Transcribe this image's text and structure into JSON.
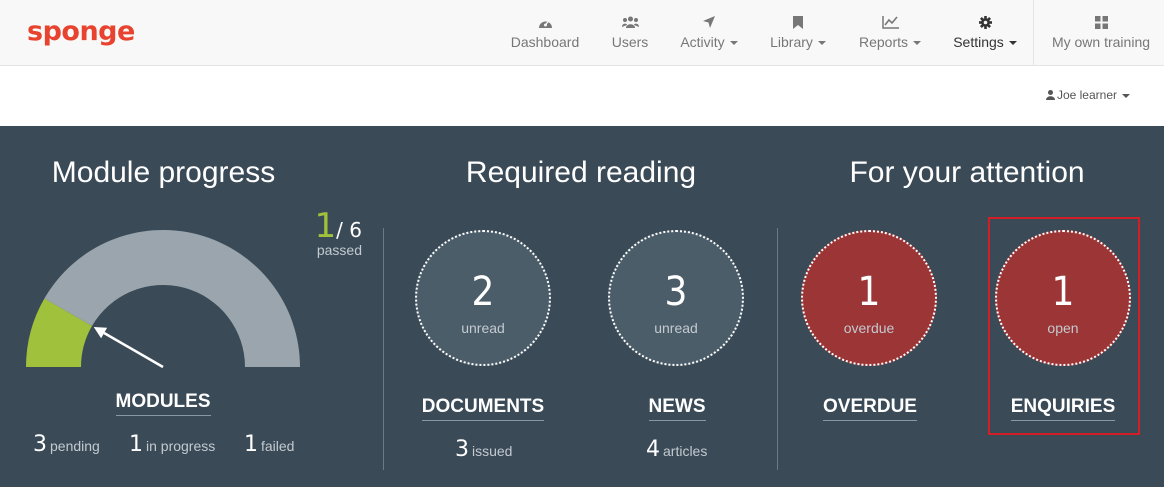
{
  "brand": {
    "logo_text": "sponge",
    "color": "#e8432e"
  },
  "nav": {
    "items": [
      {
        "label": "Dashboard",
        "icon": "dashboard-icon"
      },
      {
        "label": "Users",
        "icon": "users-icon"
      },
      {
        "label": "Activity",
        "icon": "location-arrow-icon"
      },
      {
        "label": "Library",
        "icon": "bookmark-icon"
      },
      {
        "label": "Reports",
        "icon": "line-chart-icon"
      },
      {
        "label": "Settings",
        "icon": "gear-icon"
      },
      {
        "label": "My own training",
        "icon": "grid-icon"
      }
    ]
  },
  "user": {
    "name": "Joe learner",
    "icon": "user-icon"
  },
  "module_progress": {
    "title": "Module progress",
    "passed_count": "1",
    "total": "/ 6",
    "passed_label": "passed",
    "gauge_fraction": 0.1667,
    "gauge_colors": {
      "filled": "#9fc13c",
      "remaining": "#9aa5ad"
    },
    "heading": "MODULES",
    "stats": [
      {
        "count": "3",
        "label": "pending"
      },
      {
        "count": "1",
        "label": "in progress"
      },
      {
        "count": "1",
        "label": "failed"
      }
    ]
  },
  "required_reading": {
    "title": "Required reading",
    "documents": {
      "count": "2",
      "sub": "unread",
      "heading": "DOCUMENTS",
      "stat_count": "3",
      "stat_label": "issued"
    },
    "news": {
      "count": "3",
      "sub": "unread",
      "heading": "NEWS",
      "stat_count": "4",
      "stat_label": "articles"
    }
  },
  "attention": {
    "title": "For your attention",
    "overdue": {
      "count": "1",
      "sub": "overdue",
      "heading": "OVERDUE"
    },
    "enquiries": {
      "count": "1",
      "sub": "open",
      "heading": "ENQUIRIES"
    }
  },
  "colors": {
    "panel_bg": "#3a4a57",
    "alert_red": "#9b3536",
    "highlight_border": "#d21f26"
  }
}
